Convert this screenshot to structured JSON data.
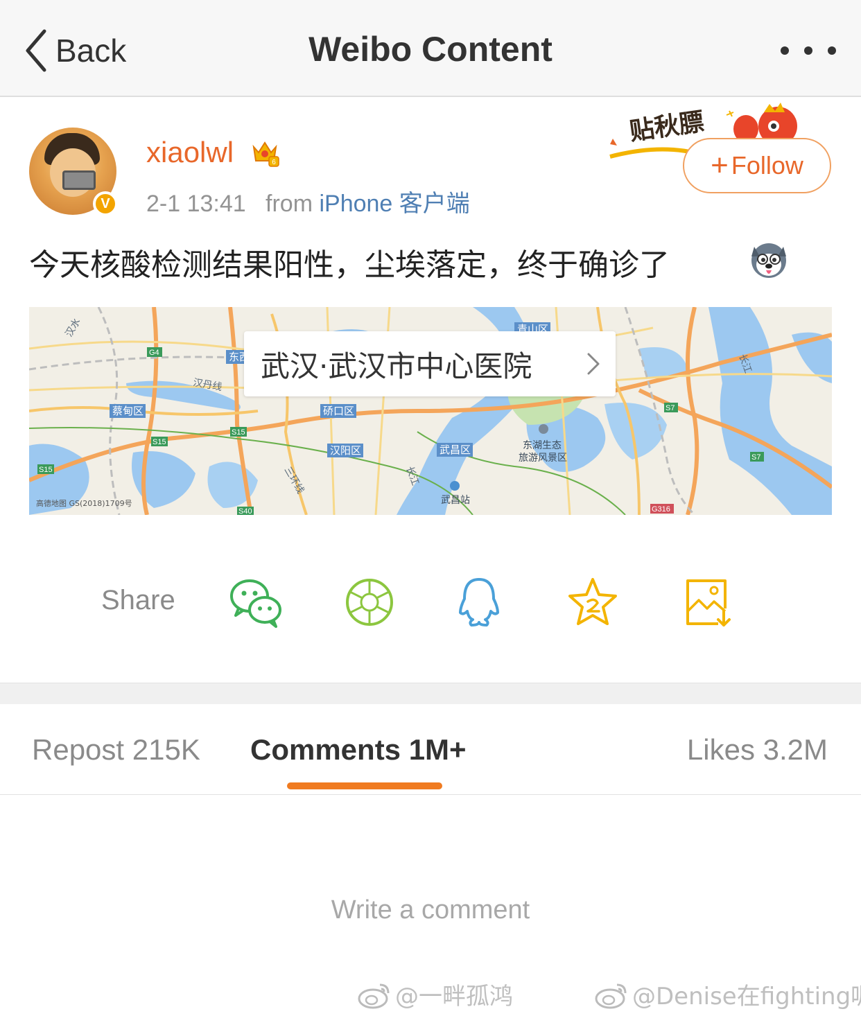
{
  "nav": {
    "back_label": "Back",
    "title": "Weibo Content"
  },
  "post": {
    "username": "xiaolwl",
    "verified_badge": "V",
    "timestamp": "2-1 13:41",
    "from_label": "from",
    "device": "iPhone 客户端",
    "follow_label": "Follow",
    "follow_plus": "+",
    "sticker_text": "贴秋膘",
    "text": "今天核酸检测结果阳性，尘埃落定，终于确诊了",
    "emoji": "husky-emoji-icon"
  },
  "map": {
    "location_label": "武汉·武汉市中心医院",
    "credit": "高德地图 GS(2018)1709号",
    "places": {
      "hanshui": "汉水",
      "caidian": "蔡甸区",
      "qiaokou": "硚口区",
      "hanyang": "汉阳区",
      "wuchang": "武昌区",
      "donghu": "东湖生态",
      "donghu2": "旅游风景区",
      "wuchang_station": "武昌站",
      "qingshan": "青山区",
      "changjiang": "长江",
      "changjiang2": "长江",
      "hanxian": "汉丹线",
      "dongxi": "东西",
      "sanhuan": "三环线",
      "g4": "G4",
      "s15a": "S15",
      "s15b": "S15",
      "s15c": "S15",
      "s7a": "S7",
      "s7b": "S7",
      "s40": "S40",
      "g316": "G316"
    }
  },
  "share": {
    "label": "Share",
    "icons": [
      "wechat-icon",
      "moments-icon",
      "qq-icon",
      "favorites-icon",
      "save-image-icon"
    ]
  },
  "tabs": {
    "repost": "Repost 215K",
    "comments": "Comments 1M+",
    "likes": "Likes 3.2M"
  },
  "comment_box": {
    "placeholder": "Write a comment"
  },
  "watermarks": [
    "@一畔孤鸿",
    "@Denise在fighting呢"
  ],
  "colors": {
    "accent": "#e8672a",
    "tab_underline": "#f07b20",
    "link": "#4f7fb3",
    "wechat": "#3fb058",
    "moments": "#8cc63f",
    "qq": "#4aa0d8",
    "favorites": "#f3b400"
  }
}
